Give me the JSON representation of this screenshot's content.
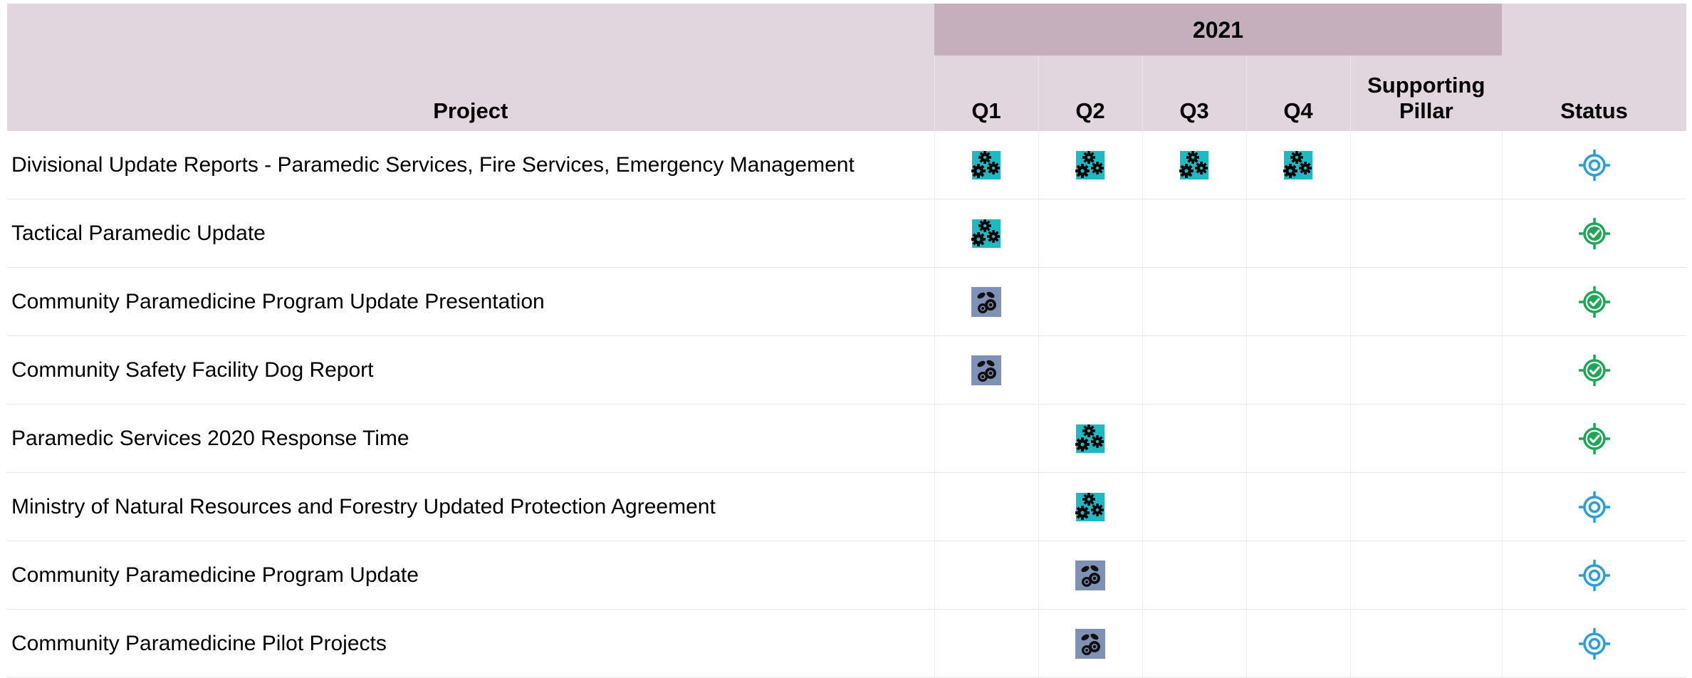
{
  "header": {
    "project_label": "Project",
    "year_label": "2021",
    "q1_label": "Q1",
    "q2_label": "Q2",
    "q3_label": "Q3",
    "q4_label": "Q4",
    "pillar_label_line1": "Supporting",
    "pillar_label_line2": "Pillar",
    "status_label": "Status"
  },
  "colors": {
    "header_bg": "#e1d6dd",
    "year_bg": "#c5afbc",
    "gears_icon_bg": "#1fb9c4",
    "bundle_icon_bg": "#7d92b5",
    "status_in_progress": "#2a9fd6",
    "status_complete": "#1fa758"
  },
  "rows": [
    {
      "project": "Divisional Update Reports - Paramedic Services, Fire Services, Emergency Management",
      "q1": "gears-icon",
      "q2": "gears-icon",
      "q3": "gears-icon",
      "q4": "gears-icon",
      "pillar": "",
      "status": "target-icon"
    },
    {
      "project": "Tactical Paramedic Update",
      "q1": "gears-icon",
      "q2": "",
      "q3": "",
      "q4": "",
      "pillar": "",
      "status": "target-check-icon"
    },
    {
      "project": "Community Paramedicine Program Update Presentation",
      "q1": "bundle-icon",
      "q2": "",
      "q3": "",
      "q4": "",
      "pillar": "",
      "status": "target-check-icon"
    },
    {
      "project": "Community Safety Facility Dog Report",
      "q1": "bundle-icon",
      "q2": "",
      "q3": "",
      "q4": "",
      "pillar": "",
      "status": "target-check-icon"
    },
    {
      "project": "Paramedic Services 2020 Response Time",
      "q1": "",
      "q2": "gears-icon",
      "q3": "",
      "q4": "",
      "pillar": "",
      "status": "target-check-icon"
    },
    {
      "project": "Ministry of Natural Resources and Forestry Updated Protection Agreement",
      "q1": "",
      "q2": "gears-icon",
      "q3": "",
      "q4": "",
      "pillar": "",
      "status": "target-icon"
    },
    {
      "project": "Community Paramedicine Program Update",
      "q1": "",
      "q2": "bundle-icon",
      "q3": "",
      "q4": "",
      "pillar": "",
      "status": "target-icon"
    },
    {
      "project": "Community Paramedicine Pilot Projects",
      "q1": "",
      "q2": "bundle-icon",
      "q3": "",
      "q4": "",
      "pillar": "",
      "status": "target-icon"
    }
  ]
}
